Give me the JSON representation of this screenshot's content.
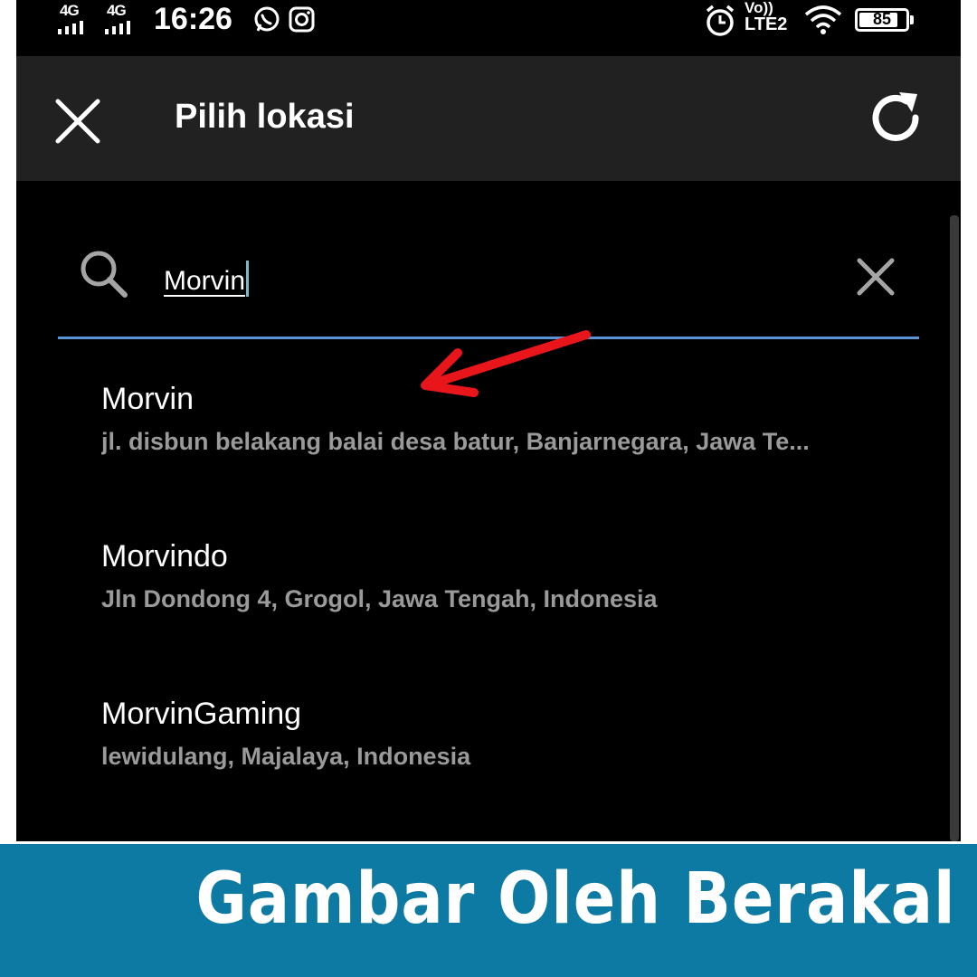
{
  "status_bar": {
    "network_1": "4G",
    "network_2": "4G",
    "time": "16:26",
    "notification_icons": [
      "whatsapp-icon",
      "instagram-icon"
    ],
    "system_icons": [
      "alarm-icon",
      "volte-icon",
      "wifi-icon",
      "battery-icon"
    ],
    "volte_line1": "Vo))",
    "volte_line2": "LTE2",
    "battery_level": "85"
  },
  "app_bar": {
    "title": "Pilih lokasi",
    "close_icon": "close-icon",
    "refresh_icon": "refresh-icon"
  },
  "search": {
    "value": "Morvin",
    "icon": "search-icon",
    "clear_icon": "clear-icon"
  },
  "results": [
    {
      "name": "Morvin",
      "address": "jl. disbun belakang balai desa batur, Banjarnegara, Jawa Te..."
    },
    {
      "name": "Morvindo",
      "address": "Jln Dondong 4, Grogol, Jawa Tengah, Indonesia"
    },
    {
      "name": "MorvinGaming",
      "address": "lewidulang, Majalaya, Indonesia"
    }
  ],
  "annotation": {
    "arrow_color": "#e8151b",
    "arrow_target": "results.0"
  },
  "banner": {
    "text": "Gambar Oleh Berakal",
    "background": "#0d7aa3"
  }
}
